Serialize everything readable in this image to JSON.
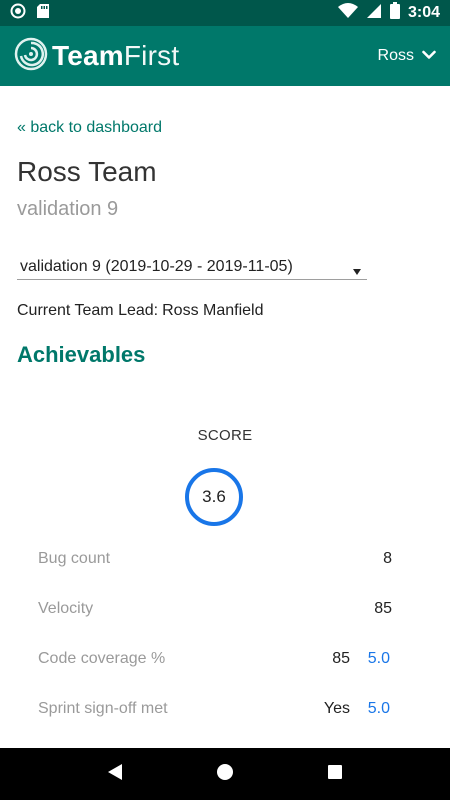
{
  "status_bar": {
    "time": "3:04",
    "icons": [
      "circle-notification-icon",
      "sd-card-icon",
      "wifi-icon",
      "signal-icon",
      "battery-icon"
    ]
  },
  "app_bar": {
    "logo_bold": "Team",
    "logo_light": "First",
    "user_name": "Ross",
    "background_color": "#00786a"
  },
  "navigation": {
    "back_link": "« back to dashboard"
  },
  "team": {
    "title": "Ross Team",
    "subtitle": "validation 9"
  },
  "sprint_select": {
    "selected": "validation 9 (2019-10-29 - 2019-11-05)"
  },
  "team_lead": {
    "label": "Current Team Lead:",
    "name": "Ross Manfield"
  },
  "achievables": {
    "section_title": "Achievables",
    "score_label": "SCORE",
    "score_value": "3.6",
    "metrics": [
      {
        "label": "Bug count",
        "value": "8",
        "weight": ""
      },
      {
        "label": "Velocity",
        "value": "85",
        "weight": ""
      },
      {
        "label": "Code coverage %",
        "value": "85",
        "weight": "5.0"
      },
      {
        "label": "Sprint sign-off met",
        "value": "Yes",
        "weight": "5.0"
      }
    ]
  },
  "colors": {
    "primary": "#00786a",
    "primary_dark": "#00574b",
    "accent": "#1976e8",
    "muted_text": "#9a9a9a"
  }
}
